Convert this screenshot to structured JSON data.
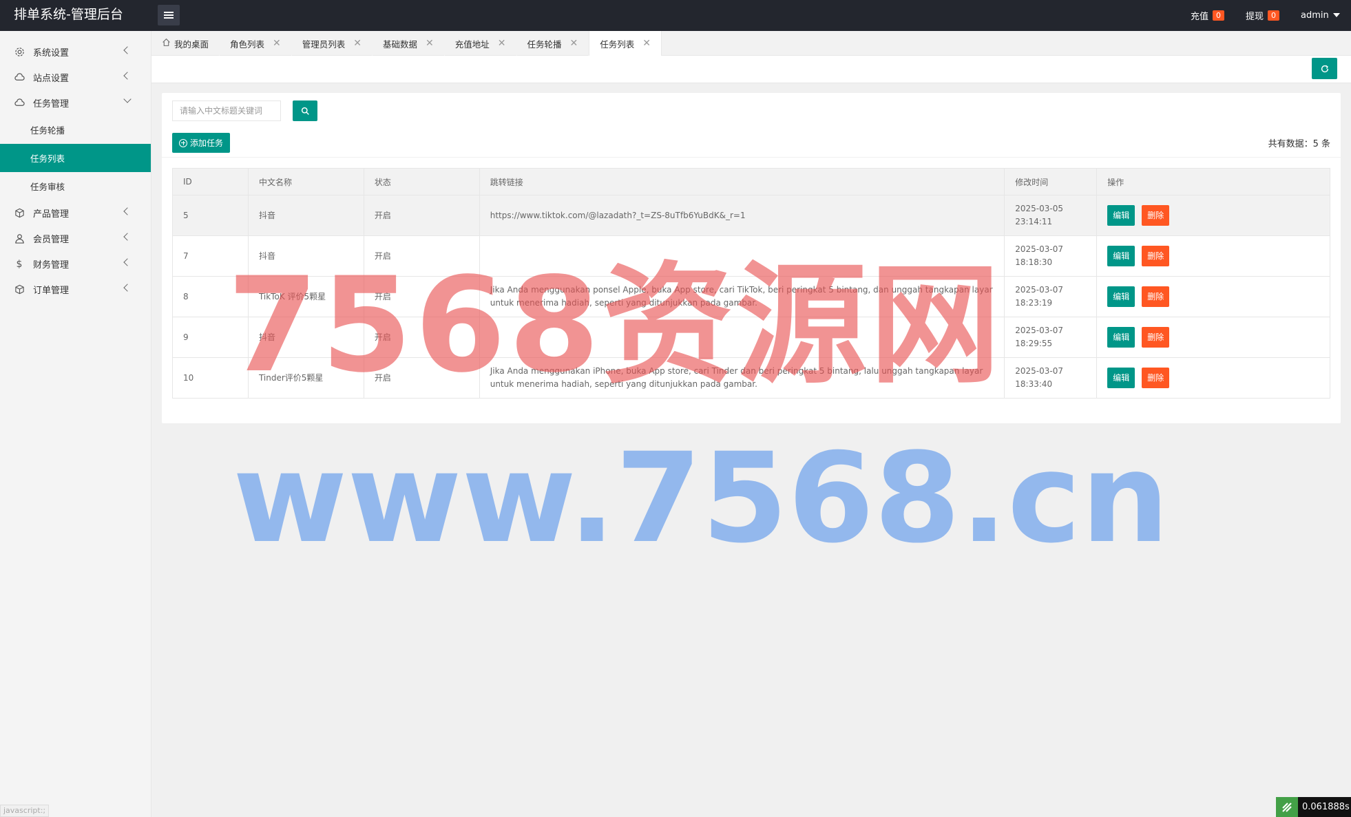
{
  "app": {
    "title": "排单系统-管理后台"
  },
  "header": {
    "recharge_label": "充值",
    "recharge_count": "0",
    "withdraw_label": "提现",
    "withdraw_count": "0",
    "user": "admin"
  },
  "sidebar": {
    "items": [
      {
        "label": "系统设置",
        "icon": "gear-icon"
      },
      {
        "label": "站点设置",
        "icon": "cloud-icon"
      },
      {
        "label": "任务管理",
        "icon": "cloud-icon"
      },
      {
        "label": "产品管理",
        "icon": "box-icon"
      },
      {
        "label": "会员管理",
        "icon": "user-icon"
      },
      {
        "label": "财务管理",
        "icon": "dollar-icon"
      },
      {
        "label": "订单管理",
        "icon": "box-icon"
      }
    ],
    "subitems": [
      {
        "label": "任务轮播"
      },
      {
        "label": "任务列表"
      },
      {
        "label": "任务审核"
      }
    ]
  },
  "tabs": [
    {
      "label": "我的桌面"
    },
    {
      "label": "角色列表"
    },
    {
      "label": "管理员列表"
    },
    {
      "label": "基础数据"
    },
    {
      "label": "充值地址"
    },
    {
      "label": "任务轮播"
    },
    {
      "label": "任务列表"
    }
  ],
  "search": {
    "placeholder": "请输入中文标题关键词"
  },
  "actions": {
    "add_label": "添加任务",
    "total_text": "共有数据：5 条",
    "edit_label": "编辑",
    "delete_label": "删除"
  },
  "table": {
    "columns": [
      "ID",
      "中文名称",
      "状态",
      "跳转链接",
      "修改时间",
      "操作"
    ],
    "rows": [
      {
        "id": "5",
        "name": "抖音",
        "status": "开启",
        "link": "https://www.tiktok.com/@lazadath?_t=ZS-8uTfb6YuBdK&_r=1",
        "time": "2025-03-05 23:14:11"
      },
      {
        "id": "7",
        "name": "抖音",
        "status": "开启",
        "link": "",
        "time": "2025-03-07 18:18:30"
      },
      {
        "id": "8",
        "name": "TikToK 评价5颗星",
        "status": "开启",
        "link": "Jika Anda menggunakan ponsel Apple, buka App store, cari TikTok, beri peringkat 5 bintang, dan unggah tangkapan layar untuk menerima hadiah, seperti yang ditunjukkan pada gambar.",
        "time": "2025-03-07 18:23:19"
      },
      {
        "id": "9",
        "name": "抖音",
        "status": "开启",
        "link": "",
        "time": "2025-03-07 18:29:55"
      },
      {
        "id": "10",
        "name": "Tinder评价5颗星",
        "status": "开启",
        "link": "Jika Anda menggunakan iPhone, buka App store, cari Tinder dan beri peringkat 5 bintang, lalu unggah tangkapan layar untuk menerima hadiah, seperti yang ditunjukkan pada gambar.",
        "time": "2025-03-07 18:33:40"
      }
    ]
  },
  "watermark": {
    "line1": "7568资源网",
    "line2": "www.7568.cn"
  },
  "footer": {
    "status_text": "javascript:;",
    "perf_value": "0.061888s"
  },
  "colors": {
    "primary": "#009688",
    "danger": "#ff5722",
    "header_bg": "#23262e"
  }
}
